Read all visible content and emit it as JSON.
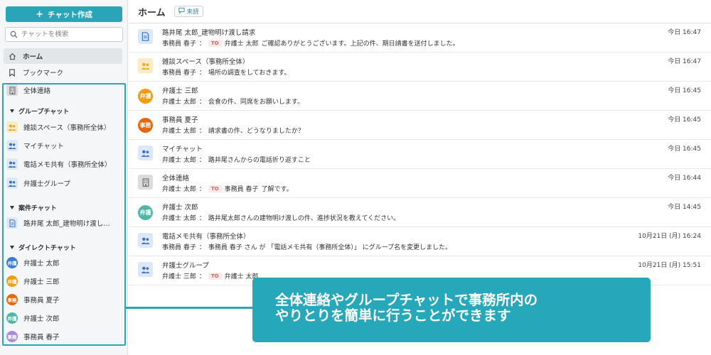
{
  "sidebar": {
    "create_button": "チャット作成",
    "search_placeholder": "チャットを検索",
    "nav": [
      {
        "label": "ホーム",
        "icon": "home-icon"
      },
      {
        "label": "ブックマーク",
        "icon": "bookmark-icon"
      }
    ],
    "all_contact": "全体連絡",
    "group_chat_header": "グループチャット",
    "group_chats": [
      "雑談スペース（事務所全体）",
      "マイチャット",
      "電話メモ共有（事務所全体）",
      "弁護士グループ"
    ],
    "case_chat_header": "案件チャット",
    "case_chats": [
      "路井尾 太郎_建物明け渡し請求"
    ],
    "direct_chat_header": "ダイレクトチャット",
    "direct_chats": [
      {
        "name": "弁護士 太郎",
        "avatar": "弁護",
        "color": "#3a7bd5"
      },
      {
        "name": "弁護士 三郎",
        "avatar": "弁護",
        "color": "#f39c12"
      },
      {
        "name": "事務員 夏子",
        "avatar": "事務",
        "color": "#e8650a"
      },
      {
        "name": "弁護士 次郎",
        "avatar": "弁護",
        "color": "#4fb7a4"
      },
      {
        "name": "事務員 春子",
        "avatar": "事務",
        "color": "#a78bd6"
      }
    ]
  },
  "header": {
    "title": "ホーム",
    "unread_label": "未読"
  },
  "messages": [
    {
      "title": "路井尾 太郎_建物明け渡し請求",
      "sender": "事務員 春子",
      "sep": "：",
      "to": "TO",
      "to_name": "弁護士 太郎",
      "text": "ご確認ありがとうございます。上記の件、期日請書を送付しました。",
      "time": "今日 16:47"
    },
    {
      "title": "雑談スペース（事務所全体）",
      "sender": "事務員 春子",
      "sep": "：",
      "text": "場所の調査をしておきます。",
      "time": "今日 16:47"
    },
    {
      "title": "弁護士 三郎",
      "sender": "弁護士 太郎",
      "sep": "：",
      "text": "会食の件、同席をお願いします。",
      "time": "今日 16:45"
    },
    {
      "title": "事務員 夏子",
      "sender": "弁護士 太郎",
      "sep": "：",
      "text": "請求書の件、どうなりましたか？",
      "time": "今日 16:45"
    },
    {
      "title": "マイチャット",
      "sender": "弁護士 太郎",
      "sep": "：",
      "text": "路井尾さんからの電話折り返すこと",
      "time": "今日 16:45"
    },
    {
      "title": "全体連絡",
      "sender": "弁護士 太郎",
      "sep": "：",
      "to": "TO",
      "to_name": "事務員 春子",
      "text": "了解です。",
      "time": "今日 16:44"
    },
    {
      "title": "弁護士 次郎",
      "sender": "弁護士 太郎",
      "sep": "：",
      "text": "路井尾太郎さんの建物明け渡しの件、進捗状況を教えてください。",
      "time": "今日 14:45"
    },
    {
      "title": "電話メモ共有（事務所全体）",
      "sender": "事務員 春子",
      "sep": "：",
      "text": "事務員 春子 さん が 「電話メモ共有（事務所全体）」 にグループ名を変更しました。",
      "time": "10月21日 (月) 16:24"
    },
    {
      "title": "弁護士グループ",
      "sender": "弁護士 三郎",
      "sep": "：",
      "to": "TO",
      "to_name": "弁護士 太郎",
      "text": "",
      "time": "10月21日 (月) 15:51"
    }
  ],
  "callout": {
    "line1": "全体連絡やグループチャットで事務所内の",
    "line2": "やりとりを簡単に行うことができます"
  },
  "colors": {
    "accent": "#2aa5b8",
    "callout": "#27a7ba",
    "to_tag_bg": "#fde7e7",
    "to_tag_text": "#e06060"
  }
}
